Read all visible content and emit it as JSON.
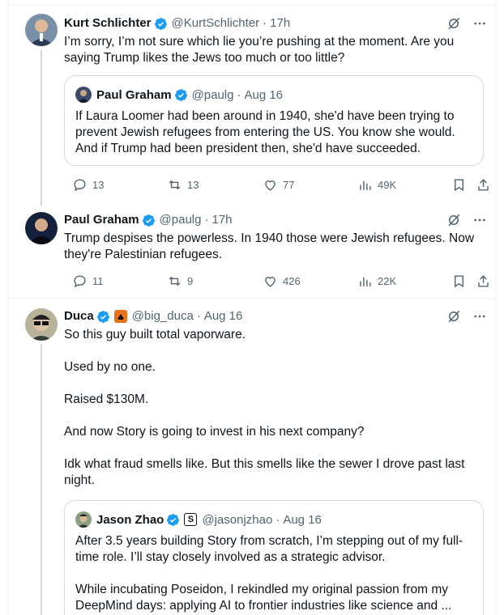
{
  "tweets": [
    {
      "name": "Kurt Schlichter",
      "handle": "@KurtSchlichter",
      "time": "17h",
      "text": "I’m sorry, I’m not sure which lie you’re pushing at the moment. Are you saying Trump likes the Jews too much or too little?",
      "quote": {
        "name": "Paul Graham",
        "handle": "@paulg",
        "time": "Aug 16",
        "text": "If Laura Loomer had been around in 1940, she'd have been trying to prevent Jewish refugees from entering the US. You know she would. And if Trump had been president then, she'd have succeeded."
      },
      "replies": "13",
      "reposts": "13",
      "likes": "77",
      "views": "49K"
    },
    {
      "name": "Paul Graham",
      "handle": "@paulg",
      "time": "17h",
      "text": "Trump despises the powerless. In 1940 those were Jewish refugees. Now they're Palestinian refugees.",
      "replies": "11",
      "reposts": "9",
      "likes": "426",
      "views": "22K"
    },
    {
      "name": "Duca",
      "handle": "@big_duca",
      "time": "Aug 16",
      "paragraphs": [
        "So this guy built total vaporware.",
        "Used by no one.",
        "Raised $130M.",
        "And now Story is going to invest in his next company?",
        "Idk what fraud smells like. But this smells like the sewer I drove past last night."
      ],
      "quote": {
        "name": "Jason Zhao",
        "badge": "S",
        "handle": "@jasonjzhao",
        "time": "Aug 16",
        "paragraphs": [
          "After 3.5 years building Story from scratch, I’m stepping out of my full-time role. I’ll stay closely involved as a strategic advisor.",
          "While incubating Poseidon, I rekindled my original passion from my DeepMind days: applying AI to frontier industries like science and ..."
        ]
      }
    }
  ],
  "separator": "·",
  "colors": {
    "verified": "#1d9bf0",
    "text": "#0f1419",
    "muted": "#536471",
    "border": "#cfd9de",
    "affiliate_badge": "#e8711c"
  }
}
